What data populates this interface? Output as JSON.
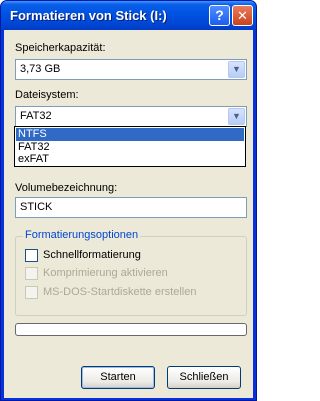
{
  "window": {
    "title": "Formatieren von Stick (I:)",
    "help_glyph": "?",
    "close_glyph": "✕"
  },
  "capacity": {
    "label": "Speicherkapazität:",
    "value": "3,73 GB"
  },
  "filesystem": {
    "label": "Dateisystem:",
    "value": "FAT32",
    "options": [
      "NTFS",
      "FAT32",
      "exFAT"
    ],
    "highlighted": "NTFS"
  },
  "volume": {
    "label": "Volumebezeichnung:",
    "value": "STICK"
  },
  "options": {
    "title": "Formatierungsoptionen",
    "quick": {
      "label": "Schnellformatierung",
      "checked": false,
      "enabled": true
    },
    "compress": {
      "label": "Komprimierung aktivieren",
      "checked": false,
      "enabled": false
    },
    "msdos": {
      "label": "MS-DOS-Startdiskette erstellen",
      "checked": false,
      "enabled": false
    }
  },
  "progress": {
    "value": 0
  },
  "buttons": {
    "start": "Starten",
    "close": "Schließen"
  },
  "colors": {
    "title_bar": "#0054e3",
    "dialog_bg": "#ece9d8",
    "selection": "#316ac5",
    "group_title": "#0046d5"
  }
}
